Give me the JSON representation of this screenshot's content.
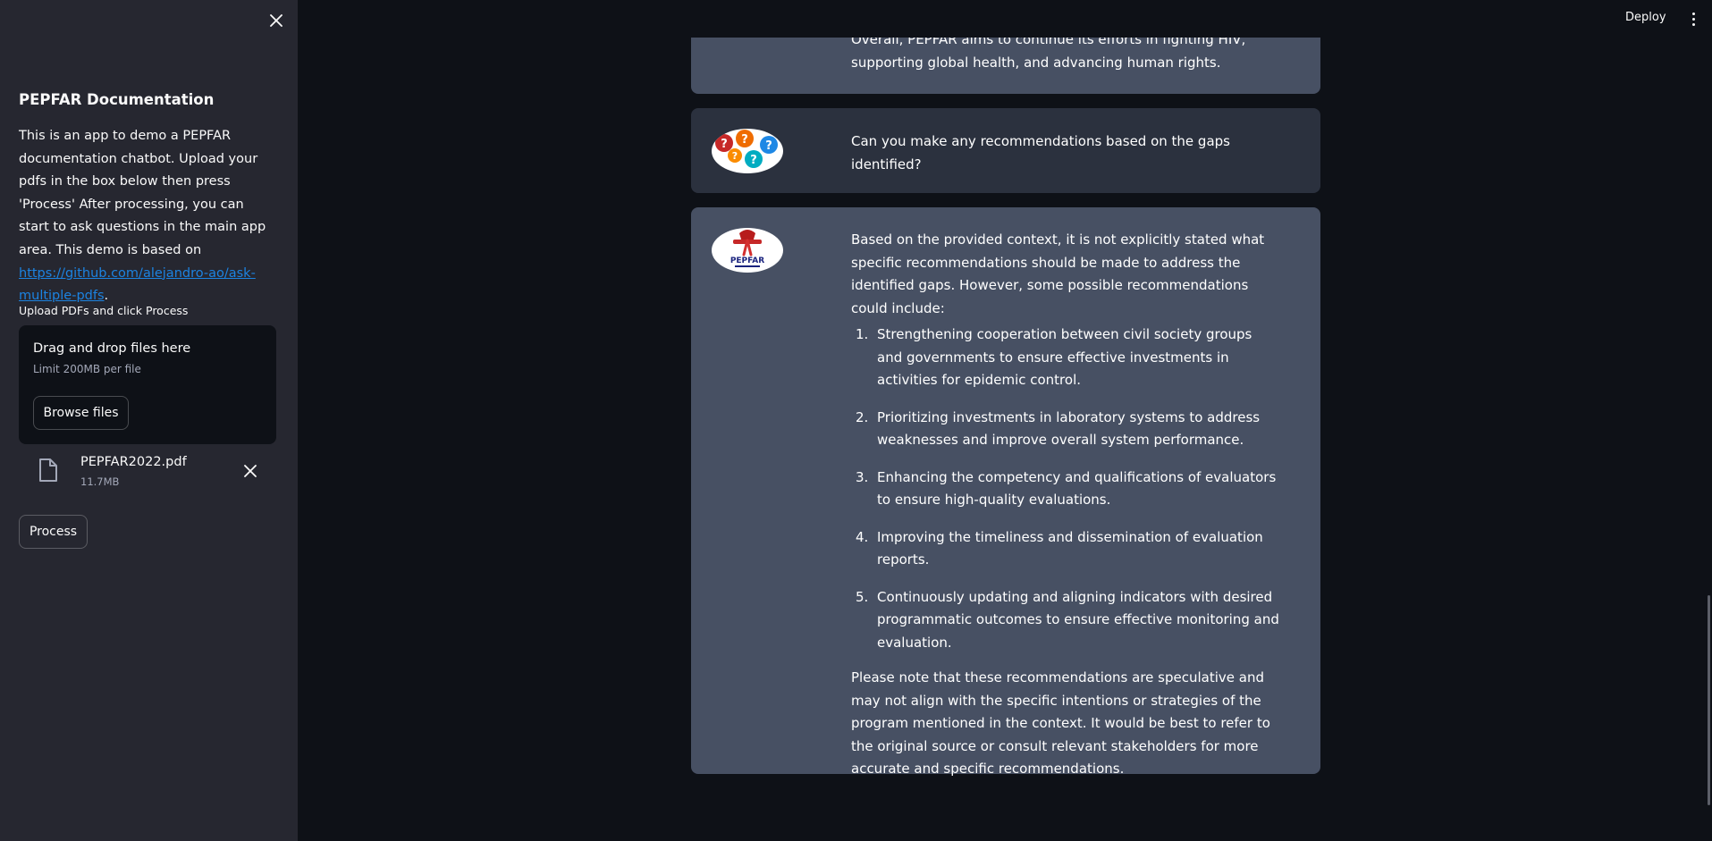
{
  "header": {
    "deploy_label": "Deploy"
  },
  "sidebar": {
    "title": "PEPFAR Documentation",
    "description": "This is an app to demo a PEPFAR documentation chatbot. Upload your pdfs in the box below then press 'Process' After processing, you can start to ask questions in the main app area. This demo is based on ",
    "link_text": "https://github.com/alejandro-ao/ask-multiple-pdfs",
    "description_end": ".",
    "upload_label": "Upload PDFs and click Process",
    "dropzone": {
      "main_text": "Drag and drop files here",
      "limit_text": "Limit 200MB per file",
      "browse_label": "Browse files"
    },
    "file": {
      "name": "PEPFAR2022.pdf",
      "size": "11.7MB"
    },
    "process_label": "Process"
  },
  "chat": {
    "prev_bot_tail": "Overall, PEPFAR aims to continue its efforts in fighting HIV, supporting global health, and advancing human rights.",
    "user_question": "Can you make any recommendations based on the gaps identified?",
    "bot_intro": "Based on the provided context, it is not explicitly stated what specific recommendations should be made to address the identified gaps. However, some possible recommendations could include:",
    "recommendations": [
      {
        "num": "1.",
        "text": "Strengthening cooperation between civil society groups and governments to ensure effective investments in activities for epidemic control."
      },
      {
        "num": "2.",
        "text": "Prioritizing investments in laboratory systems to address weaknesses and improve overall system performance."
      },
      {
        "num": "3.",
        "text": "Enhancing the competency and qualifications of evaluators to ensure high-quality evaluations."
      },
      {
        "num": "4.",
        "text": "Improving the timeliness and dissemination of evaluation reports."
      },
      {
        "num": "5.",
        "text": "Continuously updating and aligning indicators with desired programmatic outcomes to ensure effective monitoring and evaluation."
      }
    ],
    "bot_outro": "Please note that these recommendations are speculative and may not align with the specific intentions or strategies of the program mentioned in the context. It would be best to refer to the original source or consult relevant stakeholders for more accurate and specific recommendations.",
    "bot_avatar_label": "PEPFAR"
  },
  "colors": {
    "bg": "#0e1117",
    "sidebar_bg": "#262730",
    "bot_msg_bg": "#475063",
    "user_msg_bg": "#2b313e",
    "link": "#1c83e1"
  },
  "icons": {
    "sidebar_close": "close-icon",
    "file": "file-icon",
    "file_remove": "close-icon",
    "menu": "kebab-menu-icon"
  }
}
